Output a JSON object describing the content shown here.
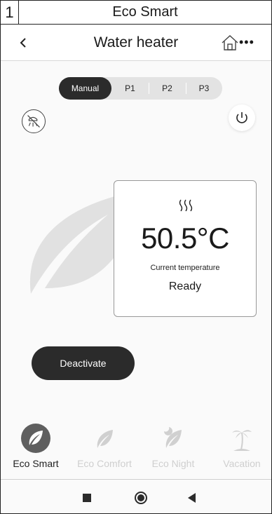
{
  "caption": {
    "number": "1",
    "title": "Eco Smart"
  },
  "header": {
    "title": "Water heater"
  },
  "tabs": [
    {
      "label": "Manual",
      "active": true
    },
    {
      "label": "P1",
      "active": false
    },
    {
      "label": "P2",
      "active": false
    },
    {
      "label": "P3",
      "active": false
    }
  ],
  "card": {
    "temperature": "50.5°C",
    "caption": "Current temperature",
    "status": "Ready"
  },
  "deactivate_label": "Deactivate",
  "modes": [
    {
      "label": "Eco Smart",
      "icon": "leaf-icon",
      "active": true
    },
    {
      "label": "Eco Comfort",
      "icon": "leaf-icon",
      "active": false
    },
    {
      "label": "Eco Night",
      "icon": "leaf-moon-icon",
      "active": false
    },
    {
      "label": "Vacation",
      "icon": "palm-tree-icon",
      "active": false
    }
  ],
  "colors": {
    "dark": "#2b2b2b",
    "inactive": "#cfcfcf",
    "leaf_watermark": "#e1e1e1"
  }
}
